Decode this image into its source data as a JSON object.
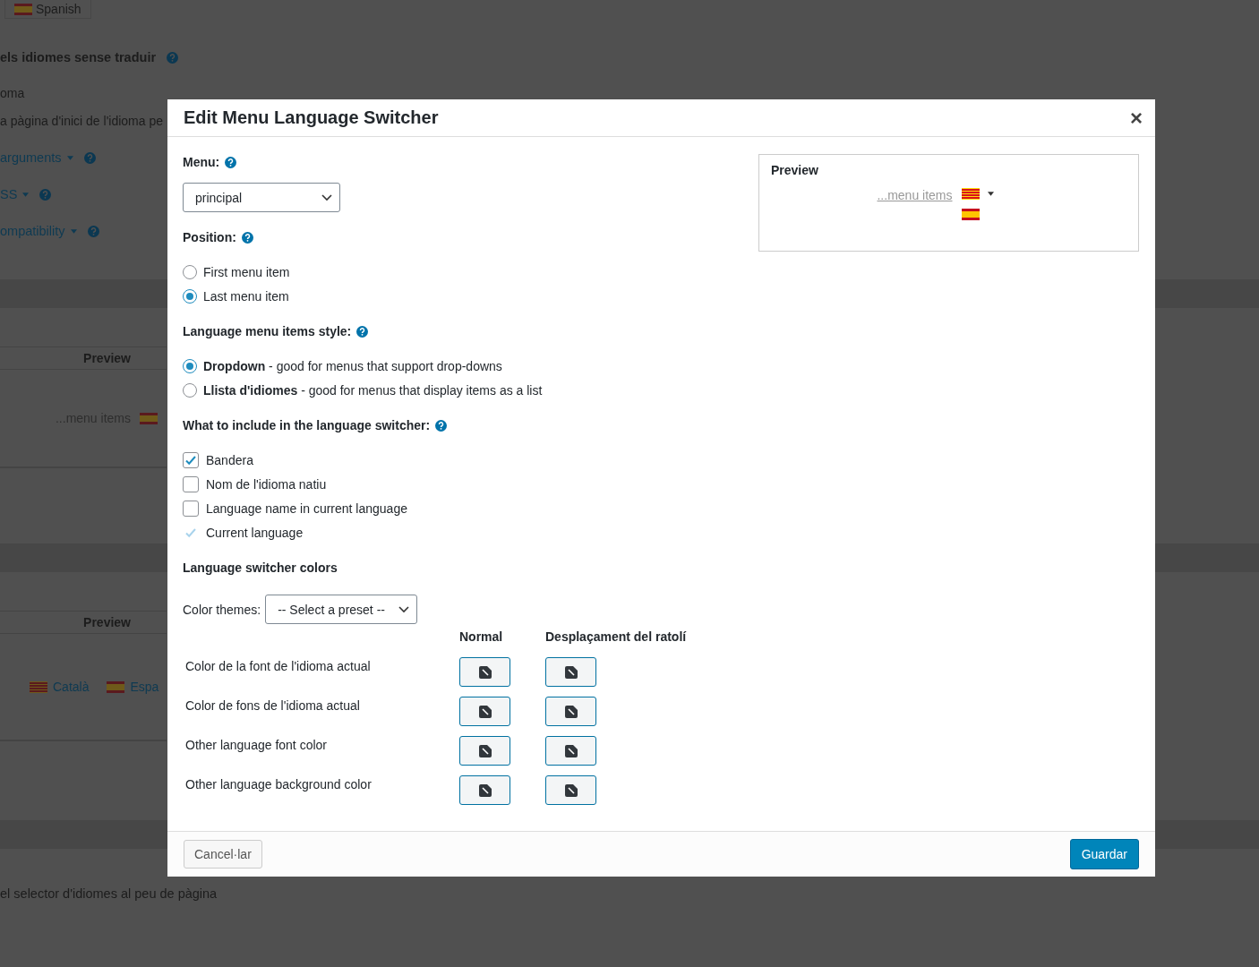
{
  "background_page": {
    "language_button": "Spanish",
    "lines": [
      {
        "kind": "heading",
        "text": "els idiomes sense traduir"
      },
      {
        "kind": "text",
        "text": "oma"
      },
      {
        "kind": "text",
        "text": "a pàgina d'inici de l'idioma pe"
      },
      {
        "kind": "link",
        "text": "arguments"
      },
      {
        "kind": "link",
        "text": "SS"
      },
      {
        "kind": "link",
        "text": "ompatibility"
      }
    ],
    "preview_1": {
      "title": "Preview",
      "menu_items": "...menu items",
      "languages": [
        {
          "kind": "spanish"
        }
      ]
    },
    "preview_2": {
      "title": "Preview",
      "languages": [
        {
          "kind": "catalan",
          "label": "Català"
        },
        {
          "kind": "spanish",
          "label": "Espa"
        }
      ]
    },
    "footer_text": "el selector d'idiomes al peu de pàgina"
  },
  "dialog": {
    "title": "Edit Menu Language Switcher",
    "close": "×",
    "menu": {
      "label": "Menu:",
      "value": "principal"
    },
    "position": {
      "label": "Position:",
      "options": [
        {
          "label": "First menu item",
          "selected": false
        },
        {
          "label": "Last menu item",
          "selected": true
        }
      ]
    },
    "style": {
      "label": "Language menu items style:",
      "options": [
        {
          "name": "Dropdown",
          "description": " - good for menus that support drop-downs",
          "selected": true
        },
        {
          "name": "Llista d'idiomes",
          "description": " - good for menus that display items as a list",
          "selected": false
        }
      ]
    },
    "include": {
      "label": "What to include in the language switcher:",
      "options": [
        {
          "label": "Bandera",
          "checked": true,
          "disabled": false
        },
        {
          "label": "Nom de l'idioma natiu",
          "checked": false,
          "disabled": false
        },
        {
          "label": "Language name in current language",
          "checked": false,
          "disabled": false
        },
        {
          "label": "Current language",
          "checked": true,
          "disabled": true
        }
      ]
    },
    "colors": {
      "title": "Language switcher colors",
      "themes_label": "Color themes:",
      "preset": "-- Select a preset --",
      "columns": [
        "Normal",
        "Desplaçament del ratolí"
      ],
      "rows": [
        "Color de la font de l'idioma actual",
        "Color de fons de l'idioma actual",
        "Other language font color",
        "Other language background color"
      ]
    },
    "preview": {
      "title": "Preview",
      "menu_items": "...menu items",
      "languages": [
        {
          "kind": "catalan"
        },
        {
          "kind": "spanish"
        }
      ]
    },
    "buttons": {
      "cancel": "Cancel·lar",
      "save": "Guardar"
    }
  }
}
